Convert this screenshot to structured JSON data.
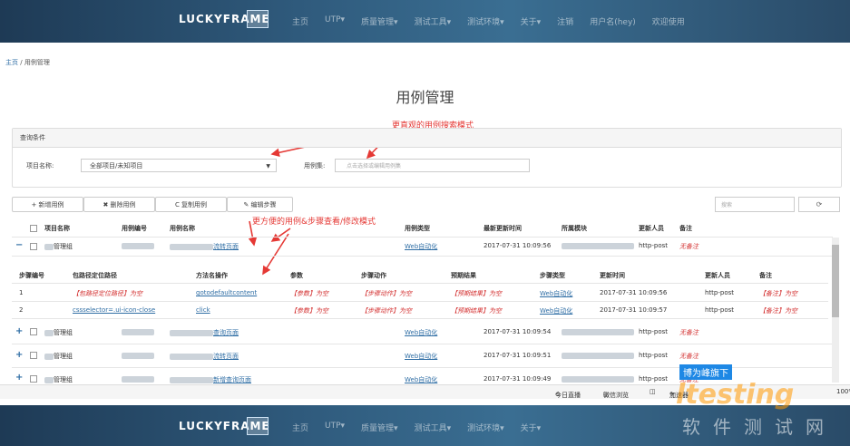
{
  "header": {
    "logo": "LUCKYFRAME",
    "nav": [
      "主页",
      "UTP▾",
      "质量管理▾",
      "测试工具▾",
      "测试环境▾",
      "关于▾",
      "注销",
      "用户名(hey)",
      "欢迎使用"
    ]
  },
  "breadcrumb": {
    "home": "主页",
    "sep": "/",
    "current": "用例管理"
  },
  "page_title": "用例管理",
  "annotations": {
    "search": "更直观的用例搜索模式",
    "steps": "更方便的用例&步骤查看/修改模式"
  },
  "query": {
    "header": "查询条件",
    "project_label": "项目名称:",
    "project_value": "全部项目/未知项目",
    "caseset_label": "用例集:",
    "caseset_placeholder": "点击选择或编辑用例集"
  },
  "toolbar": {
    "add": "+ 新增用例",
    "delete": "✖ 删除用例",
    "copy": "C 复制用例",
    "edit_steps": "✎ 编辑步骤",
    "search_placeholder": "搜索",
    "refresh": "⟳"
  },
  "table": {
    "headers": [
      "项目名称",
      "用例编号",
      "用例名称",
      "用例类型",
      "最新更新时间",
      "所属模块",
      "更新人员",
      "备注"
    ],
    "rows": [
      {
        "expand": "−",
        "project": "管理组",
        "name_suffix": "流转页面",
        "type": "Web自动化",
        "time": "2017-07-31 10:09:56",
        "person": "http-post",
        "note": "无备注"
      },
      {
        "expand": "+",
        "project": "管理组",
        "name_suffix": "查询页面",
        "type": "Web自动化",
        "time": "2017-07-31 10:09:54",
        "person": "http-post",
        "note": "无备注"
      },
      {
        "expand": "+",
        "project": "管理组",
        "name_suffix": "流转页面",
        "type": "Web自动化",
        "time": "2017-07-31 10:09:51",
        "person": "http-post",
        "note": "无备注"
      },
      {
        "expand": "+",
        "project": "管理组",
        "name_suffix": "新增查询页面",
        "type": "Web自动化",
        "time": "2017-07-31 10:09:49",
        "person": "http-post",
        "note": "无备注"
      }
    ]
  },
  "steps_table": {
    "headers": [
      "步骤编号",
      "包路径定位路径",
      "方法名操作",
      "参数",
      "步骤动作",
      "预期结果",
      "步骤类型",
      "更新时间",
      "更新人员",
      "备注"
    ],
    "rows": [
      {
        "no": "1",
        "path": "【包路径定位路径】为空",
        "method": "gotodefaultcontent",
        "param": "【参数】为空",
        "action": "【步骤动作】为空",
        "expected": "【预期结果】为空",
        "type": "Web自动化",
        "time": "2017-07-31 10:09:56",
        "person": "http-post",
        "note": "【备注】为空"
      },
      {
        "no": "2",
        "path": "cssselector=.ui-icon-close",
        "method": "click",
        "param": "【参数】为空",
        "action": "【步骤动作】为空",
        "expected": "【预期结果】为空",
        "type": "Web自动化",
        "time": "2017-07-31 10:09:57",
        "person": "http-post",
        "note": "【备注】为空"
      }
    ]
  },
  "statusbar": {
    "live": "今日直播",
    "browse": "微信浏览",
    "accel": "加速器",
    "zoom": "100%"
  },
  "watermark": {
    "box": "博为峰旗下",
    "big": "ltesting",
    "cn": "软件测试网"
  }
}
